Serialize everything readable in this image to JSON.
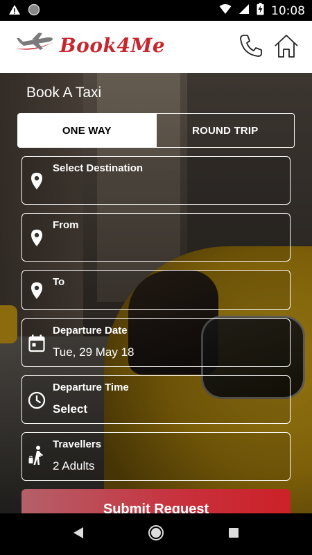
{
  "status_bar": {
    "time": "10:08",
    "icons": [
      "warning-icon",
      "circle-icon",
      "wifi-icon",
      "signal-icon",
      "battery-charging-icon"
    ]
  },
  "header": {
    "logo_text": "Book4Me",
    "icons": [
      "phone-icon",
      "home-icon"
    ],
    "brand_color": "#c8262e"
  },
  "page": {
    "title": "Book A Taxi"
  },
  "trip_type": {
    "options": [
      "ONE WAY",
      "ROUND TRIP"
    ],
    "selected": "ONE WAY"
  },
  "fields": {
    "destination": {
      "label": "Select Destination",
      "value": "",
      "icon": "location-pin-icon"
    },
    "from": {
      "label": "From",
      "value": "",
      "icon": "location-pin-icon"
    },
    "to": {
      "label": "To",
      "value": "",
      "icon": "location-pin-icon"
    },
    "departure_date": {
      "label": "Departure Date",
      "value": "Tue, 29 May 18",
      "icon": "calendar-icon"
    },
    "departure_time": {
      "label": "Departure Time",
      "value": "Select",
      "icon": "clock-icon"
    },
    "travellers": {
      "label": "Travellers",
      "value": "2 Adults",
      "icon": "traveller-icon"
    }
  },
  "submit": {
    "label": "Submit Request",
    "color": "#cc2128"
  },
  "nav_bar": {
    "icons": [
      "back-icon",
      "home-circle-icon",
      "recents-icon"
    ]
  }
}
